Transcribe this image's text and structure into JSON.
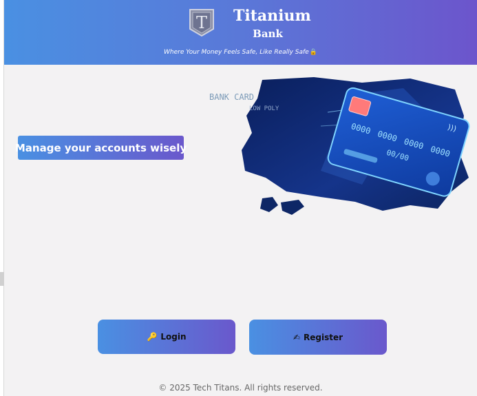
{
  "header": {
    "brand_name": "Titanium",
    "brand_sub": "Bank",
    "logo_letter": "T",
    "tagline": "Where Your Money Feels Safe, Like Really Safe",
    "tagline_icon": "lock-icon",
    "colors": {
      "gradient_start": "#4a90e2",
      "gradient_end": "#6a58cc"
    }
  },
  "hero": {
    "badge": "Manage your accounts wisely",
    "image": {
      "caption_line1": "BANK CARD",
      "caption_line2": "LOW POLY",
      "card_number_groups": [
        "0000",
        "0000",
        "0000",
        "0000"
      ],
      "card_expiry": "00/00"
    }
  },
  "actions": {
    "login": {
      "label": "Login",
      "icon": "key-icon",
      "icon_glyph": "🔑"
    },
    "register": {
      "label": "Register",
      "icon": "writing-hand-icon",
      "icon_glyph": "✍"
    }
  },
  "footer": {
    "text": "© 2025 Tech Titans. All rights reserved."
  }
}
